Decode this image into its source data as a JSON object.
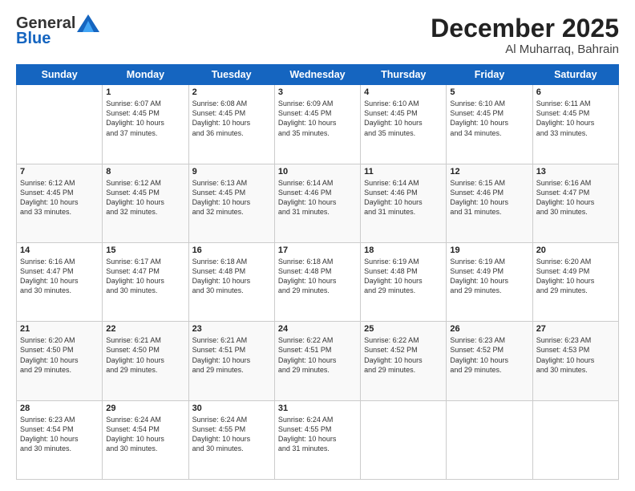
{
  "logo": {
    "general": "General",
    "blue": "Blue"
  },
  "title": "December 2025",
  "subtitle": "Al Muharraq, Bahrain",
  "days": [
    "Sunday",
    "Monday",
    "Tuesday",
    "Wednesday",
    "Thursday",
    "Friday",
    "Saturday"
  ],
  "weeks": [
    [
      {
        "day": "",
        "info": ""
      },
      {
        "day": "1",
        "info": "Sunrise: 6:07 AM\nSunset: 4:45 PM\nDaylight: 10 hours\nand 37 minutes."
      },
      {
        "day": "2",
        "info": "Sunrise: 6:08 AM\nSunset: 4:45 PM\nDaylight: 10 hours\nand 36 minutes."
      },
      {
        "day": "3",
        "info": "Sunrise: 6:09 AM\nSunset: 4:45 PM\nDaylight: 10 hours\nand 35 minutes."
      },
      {
        "day": "4",
        "info": "Sunrise: 6:10 AM\nSunset: 4:45 PM\nDaylight: 10 hours\nand 35 minutes."
      },
      {
        "day": "5",
        "info": "Sunrise: 6:10 AM\nSunset: 4:45 PM\nDaylight: 10 hours\nand 34 minutes."
      },
      {
        "day": "6",
        "info": "Sunrise: 6:11 AM\nSunset: 4:45 PM\nDaylight: 10 hours\nand 33 minutes."
      }
    ],
    [
      {
        "day": "7",
        "info": "Sunrise: 6:12 AM\nSunset: 4:45 PM\nDaylight: 10 hours\nand 33 minutes."
      },
      {
        "day": "8",
        "info": "Sunrise: 6:12 AM\nSunset: 4:45 PM\nDaylight: 10 hours\nand 32 minutes."
      },
      {
        "day": "9",
        "info": "Sunrise: 6:13 AM\nSunset: 4:45 PM\nDaylight: 10 hours\nand 32 minutes."
      },
      {
        "day": "10",
        "info": "Sunrise: 6:14 AM\nSunset: 4:46 PM\nDaylight: 10 hours\nand 31 minutes."
      },
      {
        "day": "11",
        "info": "Sunrise: 6:14 AM\nSunset: 4:46 PM\nDaylight: 10 hours\nand 31 minutes."
      },
      {
        "day": "12",
        "info": "Sunrise: 6:15 AM\nSunset: 4:46 PM\nDaylight: 10 hours\nand 31 minutes."
      },
      {
        "day": "13",
        "info": "Sunrise: 6:16 AM\nSunset: 4:47 PM\nDaylight: 10 hours\nand 30 minutes."
      }
    ],
    [
      {
        "day": "14",
        "info": "Sunrise: 6:16 AM\nSunset: 4:47 PM\nDaylight: 10 hours\nand 30 minutes."
      },
      {
        "day": "15",
        "info": "Sunrise: 6:17 AM\nSunset: 4:47 PM\nDaylight: 10 hours\nand 30 minutes."
      },
      {
        "day": "16",
        "info": "Sunrise: 6:18 AM\nSunset: 4:48 PM\nDaylight: 10 hours\nand 30 minutes."
      },
      {
        "day": "17",
        "info": "Sunrise: 6:18 AM\nSunset: 4:48 PM\nDaylight: 10 hours\nand 29 minutes."
      },
      {
        "day": "18",
        "info": "Sunrise: 6:19 AM\nSunset: 4:48 PM\nDaylight: 10 hours\nand 29 minutes."
      },
      {
        "day": "19",
        "info": "Sunrise: 6:19 AM\nSunset: 4:49 PM\nDaylight: 10 hours\nand 29 minutes."
      },
      {
        "day": "20",
        "info": "Sunrise: 6:20 AM\nSunset: 4:49 PM\nDaylight: 10 hours\nand 29 minutes."
      }
    ],
    [
      {
        "day": "21",
        "info": "Sunrise: 6:20 AM\nSunset: 4:50 PM\nDaylight: 10 hours\nand 29 minutes."
      },
      {
        "day": "22",
        "info": "Sunrise: 6:21 AM\nSunset: 4:50 PM\nDaylight: 10 hours\nand 29 minutes."
      },
      {
        "day": "23",
        "info": "Sunrise: 6:21 AM\nSunset: 4:51 PM\nDaylight: 10 hours\nand 29 minutes."
      },
      {
        "day": "24",
        "info": "Sunrise: 6:22 AM\nSunset: 4:51 PM\nDaylight: 10 hours\nand 29 minutes."
      },
      {
        "day": "25",
        "info": "Sunrise: 6:22 AM\nSunset: 4:52 PM\nDaylight: 10 hours\nand 29 minutes."
      },
      {
        "day": "26",
        "info": "Sunrise: 6:23 AM\nSunset: 4:52 PM\nDaylight: 10 hours\nand 29 minutes."
      },
      {
        "day": "27",
        "info": "Sunrise: 6:23 AM\nSunset: 4:53 PM\nDaylight: 10 hours\nand 30 minutes."
      }
    ],
    [
      {
        "day": "28",
        "info": "Sunrise: 6:23 AM\nSunset: 4:54 PM\nDaylight: 10 hours\nand 30 minutes."
      },
      {
        "day": "29",
        "info": "Sunrise: 6:24 AM\nSunset: 4:54 PM\nDaylight: 10 hours\nand 30 minutes."
      },
      {
        "day": "30",
        "info": "Sunrise: 6:24 AM\nSunset: 4:55 PM\nDaylight: 10 hours\nand 30 minutes."
      },
      {
        "day": "31",
        "info": "Sunrise: 6:24 AM\nSunset: 4:55 PM\nDaylight: 10 hours\nand 31 minutes."
      },
      {
        "day": "",
        "info": ""
      },
      {
        "day": "",
        "info": ""
      },
      {
        "day": "",
        "info": ""
      }
    ]
  ]
}
